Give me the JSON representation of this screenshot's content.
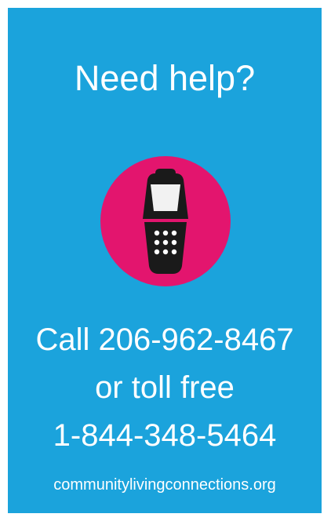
{
  "headline": "Need help?",
  "icon": {
    "name": "phone-icon",
    "circle_color": "#e3156e",
    "device_color": "#1a1a1a",
    "screen_color": "#f2f2f2"
  },
  "call": {
    "line1": "Call 206-962-8467",
    "line2": "or toll free",
    "line3": "1-844-348-5464"
  },
  "website": "communitylivingconnections.org",
  "colors": {
    "background": "#1ba3dc",
    "text": "#ffffff"
  }
}
